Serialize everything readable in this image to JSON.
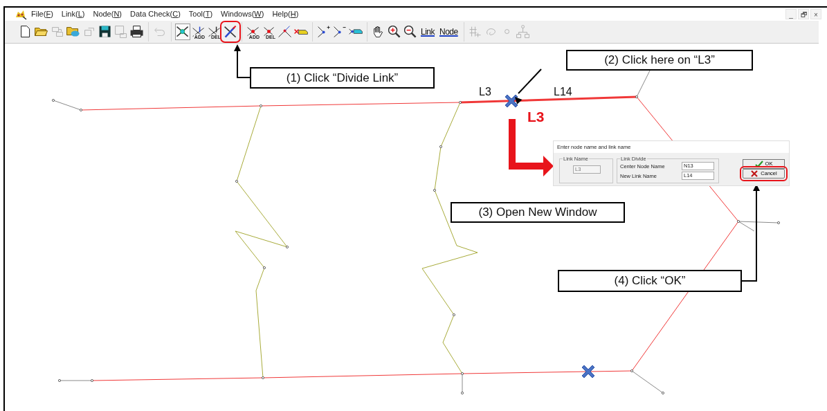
{
  "menu": [
    {
      "label": "File(F)"
    },
    {
      "label": "Link(L)"
    },
    {
      "label": "Node(N)"
    },
    {
      "label": "Data Check(C)"
    },
    {
      "label": "Tool(T)"
    },
    {
      "label": "Windows(W)"
    },
    {
      "label": "Help(H)"
    }
  ],
  "window_controls": [
    "_",
    "🗗",
    "×"
  ],
  "toolbar": [
    {
      "buttons": [
        {
          "kind": "new",
          "disabled": false
        },
        {
          "kind": "open",
          "disabled": false
        },
        {
          "kind": "import",
          "disabled": true
        },
        {
          "kind": "open-map",
          "disabled": false
        },
        {
          "kind": "export",
          "disabled": true
        },
        {
          "kind": "save",
          "disabled": false
        },
        {
          "kind": "save-as",
          "disabled": true
        },
        {
          "kind": "print",
          "disabled": false
        }
      ]
    },
    {
      "buttons": [
        {
          "kind": "undo",
          "disabled": true
        }
      ]
    },
    {
      "buttons": [
        {
          "kind": "select-link",
          "disabled": false,
          "pressed": true,
          "highlighted": false
        },
        {
          "kind": "add-link",
          "caption": "ADD",
          "disabled": false,
          "pressed": false,
          "highlighted": false
        },
        {
          "kind": "del-link",
          "caption": "DEL",
          "disabled": false,
          "pressed": false,
          "highlighted": false
        },
        {
          "kind": "divide-link",
          "disabled": false,
          "pressed": false,
          "highlighted": true
        }
      ]
    },
    {
      "buttons": [
        {
          "kind": "add-node",
          "caption": "ADD",
          "disabled": false
        },
        {
          "kind": "del-node",
          "caption": "DEL",
          "disabled": false
        },
        {
          "kind": "move-node",
          "disabled": false
        },
        {
          "kind": "car-delete",
          "disabled": false
        }
      ]
    },
    {
      "buttons": [
        {
          "kind": "node-plus",
          "disabled": false
        },
        {
          "kind": "node-minus",
          "disabled": false
        },
        {
          "kind": "car-node",
          "disabled": false
        }
      ]
    },
    {
      "buttons": [
        {
          "kind": "hand",
          "disabled": false
        },
        {
          "kind": "zoom-in",
          "disabled": false
        },
        {
          "kind": "zoom-out",
          "disabled": false
        },
        {
          "kind": "text",
          "label": "Link",
          "disabled": false
        },
        {
          "kind": "text",
          "label": "Node",
          "disabled": false
        }
      ]
    },
    {
      "buttons": [
        {
          "kind": "grid",
          "disabled": true
        },
        {
          "kind": "lasso",
          "disabled": true
        },
        {
          "kind": "circle",
          "disabled": true
        },
        {
          "kind": "tree",
          "disabled": true
        }
      ]
    }
  ],
  "map_labels": [
    {
      "text": "L3",
      "kind": "plain"
    },
    {
      "text": "L14",
      "kind": "plain"
    },
    {
      "text": "L3",
      "kind": "emphasis"
    }
  ],
  "callouts": [
    "(1) Click “Divide Link”",
    "(2) Click here on “L3”",
    "(3) Open New Window",
    "(4) Click “OK”"
  ],
  "dialog": {
    "title": "Enter node name and link name",
    "link_name": {
      "legend": "Link Name",
      "value": "L3",
      "disabled": true
    },
    "link_divide": {
      "legend": "Link Divide",
      "fields": [
        {
          "label": "Center Node Name",
          "value": "N13"
        },
        {
          "label": "New Link Name",
          "value": "L14"
        }
      ]
    },
    "buttons": [
      {
        "kind": "ok",
        "label": "OK",
        "highlighted": false
      },
      {
        "kind": "cancel",
        "label": "Cancel",
        "highlighted": true
      }
    ]
  }
}
